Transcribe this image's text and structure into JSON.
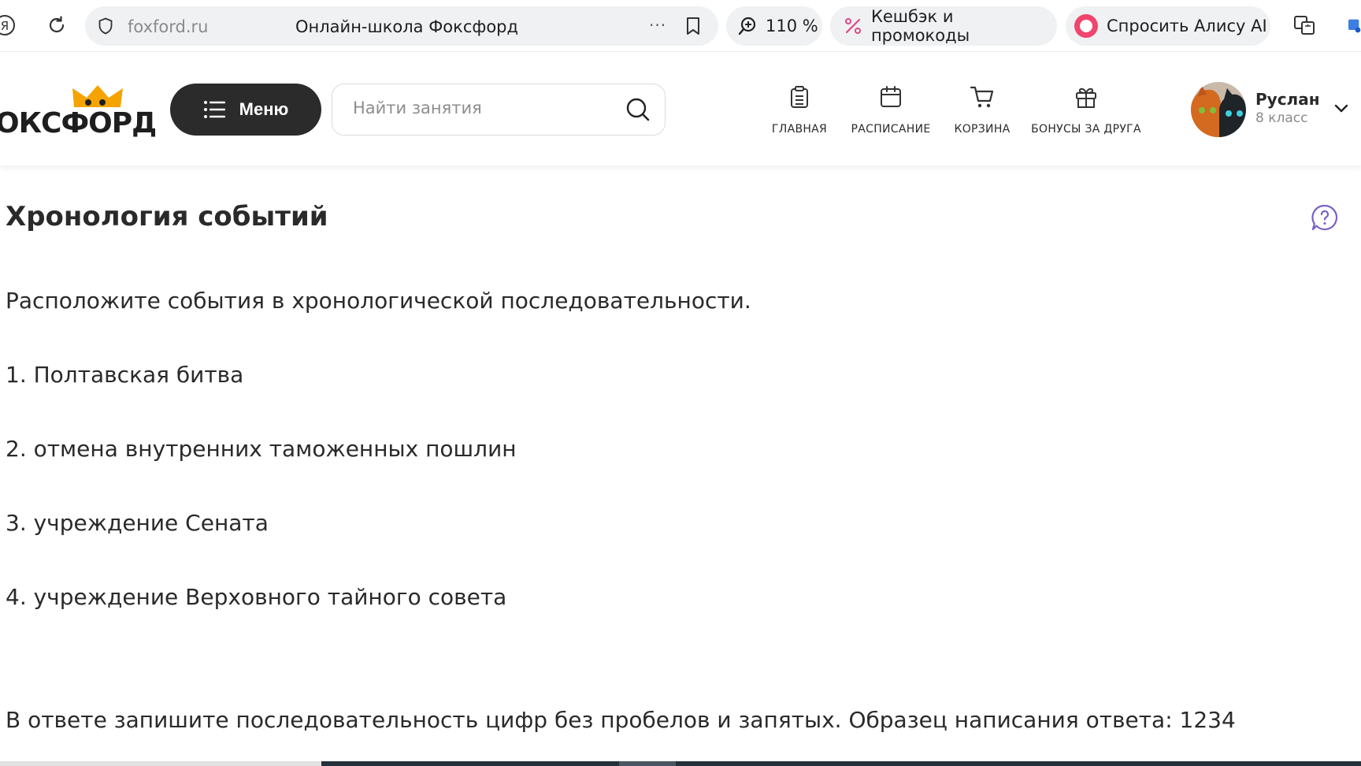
{
  "browser": {
    "yandex_label": "Я",
    "address_domain": "foxford.ru",
    "tab_title": "Онлайн-школа Фоксфорд",
    "more_label": "···",
    "zoom_label": "110 %",
    "cashback_label": "Кешбэк и промокоды",
    "alice_label": "Спросить Алису AI"
  },
  "header": {
    "logo_text": "ОКСФОРД",
    "menu_label": "Меню",
    "search_placeholder": "Найти занятия",
    "nav": [
      {
        "label": "ГЛАВНАЯ",
        "icon": "clipboard-icon"
      },
      {
        "label": "РАСПИСАНИЕ",
        "icon": "calendar-icon"
      },
      {
        "label": "КОРЗИНА",
        "icon": "cart-icon"
      },
      {
        "label": "БОНУСЫ ЗА ДРУГА",
        "icon": "gift-icon"
      }
    ],
    "user": {
      "name": "Руслан",
      "grade": "8 класс"
    }
  },
  "task": {
    "title": "Хронология событий",
    "instruction": "Расположите события в хронологической последовательности.",
    "items": [
      "1. Полтавская битва",
      "2. отмена внутренних таможенных пошлин",
      "3. учреждение Сената",
      "4. учреждение Верховного тайного совета"
    ],
    "answer_hint": "В ответе запишите последовательность цифр без пробелов и запятых. Образец написания ответа: 1234"
  },
  "colors": {
    "menu_button": "#2b2b2b",
    "help_icon": "#7b5fc7",
    "cashback_icon": "#e0468a",
    "alice_icon": "#f0456e",
    "logo_crown": "#f5a300"
  }
}
